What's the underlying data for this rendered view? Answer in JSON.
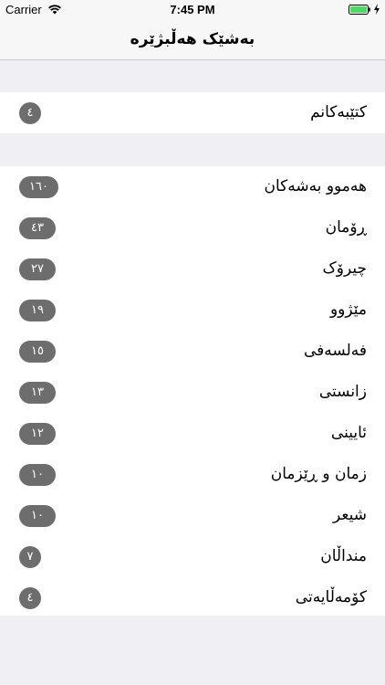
{
  "status_bar": {
    "carrier": "Carrier",
    "time": "7:45 PM"
  },
  "nav": {
    "title": "بەشێک هەڵبژێرە"
  },
  "top_section": {
    "items": [
      {
        "label": "کتێبەکانم",
        "count": "٤"
      }
    ]
  },
  "categories": {
    "items": [
      {
        "label": "هەموو بەشەکان",
        "count": "١٦٠"
      },
      {
        "label": "ڕۆمان",
        "count": "٤٣"
      },
      {
        "label": "چیرۆک",
        "count": "٢٧"
      },
      {
        "label": "مێژوو",
        "count": "١٩"
      },
      {
        "label": "فەلسەفی",
        "count": "١٥"
      },
      {
        "label": "زانستی",
        "count": "١٣"
      },
      {
        "label": "ئایینی",
        "count": "١٢"
      },
      {
        "label": "زمان و ڕێزمان",
        "count": "١٠"
      },
      {
        "label": "شیعر",
        "count": "١٠"
      },
      {
        "label": "منداڵان",
        "count": "٧"
      },
      {
        "label": "کۆمەڵایەتی",
        "count": "٤"
      }
    ]
  },
  "colors": {
    "background": "#efeff4",
    "badge": "#6d6d6d",
    "battery": "#4cd964"
  }
}
